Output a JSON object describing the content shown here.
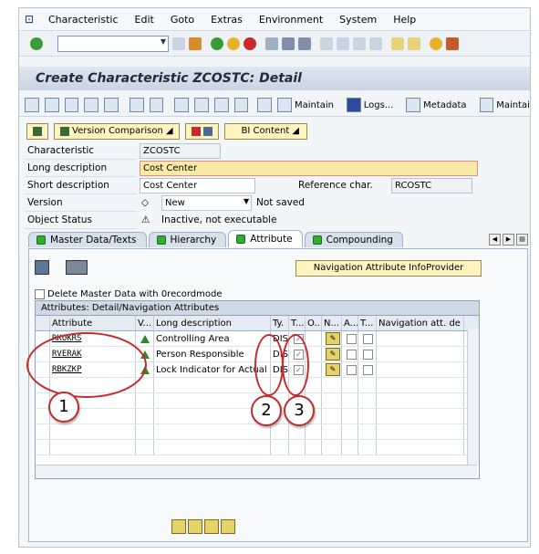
{
  "menu": [
    "Characteristic",
    "Edit",
    "Goto",
    "Extras",
    "Environment",
    "System",
    "Help"
  ],
  "title": "Create Characteristic ZCOSTC: Detail",
  "app_toolbar": {
    "maintain": "Maintain",
    "logs": "Logs...",
    "metadata": "Metadata",
    "maintain2": "Maintai"
  },
  "buttons": {
    "version_comparison": "Version Comparison",
    "bi_content": "BI Content"
  },
  "form": {
    "characteristic_label": "Characteristic",
    "characteristic_value": "ZCOSTC",
    "long_desc_label": "Long description",
    "long_desc_value": "Cost Center",
    "short_desc_label": "Short description",
    "short_desc_value": "Cost Center",
    "ref_char_label": "Reference char.",
    "ref_char_value": "RCOSTC",
    "version_label": "Version",
    "version_value": "New",
    "version_status": "Not saved",
    "object_status_label": "Object Status",
    "object_status_value": "Inactive, not executable"
  },
  "tabs": [
    "Master Data/Texts",
    "Hierarchy",
    "Attribute",
    "Compounding"
  ],
  "nav_attr_button": "Navigation Attribute InfoProvider",
  "delete_master_data": "Delete Master Data with 0recordmode",
  "grid": {
    "title": "Attributes: Detail/Navigation Attributes",
    "headers": [
      "Attribute",
      "V...",
      "Long description",
      "Ty.",
      "T...",
      "O...",
      "N...",
      "A...",
      "T...",
      "Navigation att. de"
    ],
    "rows": [
      {
        "attribute": "RKOKRS",
        "desc": "Controlling Area",
        "type": "DIS"
      },
      {
        "attribute": "RVERAK",
        "desc": "Person Responsible",
        "type": "DIS"
      },
      {
        "attribute": "RBKZKP",
        "desc": "Lock Indicator for Actual",
        "type": "DIS"
      }
    ]
  },
  "callouts": [
    "1",
    "2",
    "3"
  ]
}
